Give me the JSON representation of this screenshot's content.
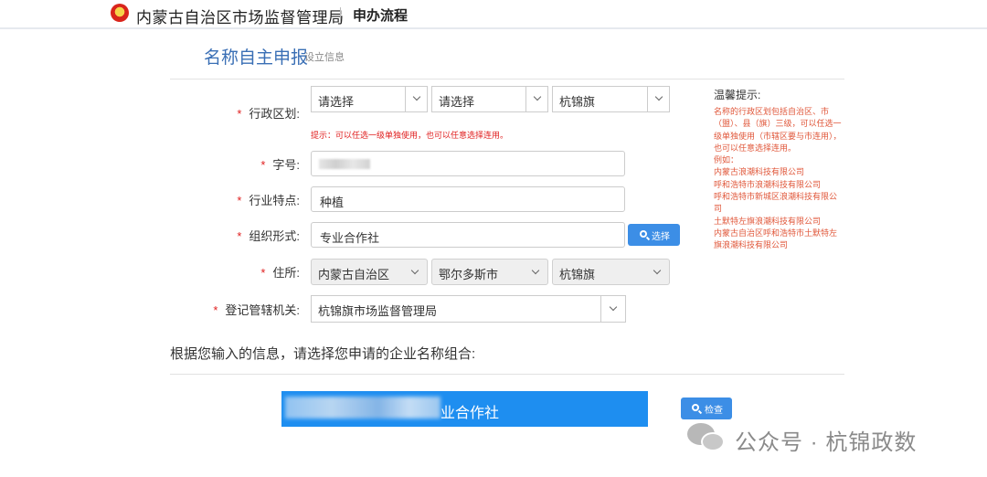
{
  "header": {
    "agency": "内蒙古自治区市场监督管理局",
    "flow_link": "申办流程"
  },
  "section": {
    "title": "名称自主申报",
    "subtitle": "设立信息"
  },
  "form": {
    "district": {
      "label": "行政区划:",
      "select1": "请选择",
      "select2": "请选择",
      "select3": "杭锦旗",
      "hint": "提示：可以任选一级单独使用，也可以任意选择连用。"
    },
    "zihao": {
      "label": "字号:"
    },
    "industry": {
      "label": "行业特点:",
      "value": "种植"
    },
    "org_form": {
      "label": "组织形式:",
      "value": "专业合作社",
      "button": "选择"
    },
    "address": {
      "label": "住所:",
      "select1": "内蒙古自治区",
      "select2": "鄂尔多斯市",
      "select3": "杭锦旗"
    },
    "authority": {
      "label": "登记管辖机关:",
      "value": "杭锦旗市场监督管理局"
    }
  },
  "tips": {
    "title": "温馨提示:",
    "lines": [
      "名称的行政区划包括自治区、市（盟）、县（旗）三级，可以任选一级单独使用（市辖区要与市连用），也可以任意选择连用。",
      "例如：",
      "内蒙古浪潮科技有限公司",
      "呼和浩特市浪潮科技有限公司",
      "呼和浩特市新城区浪潮科技有限公司",
      "土默特左旗浪潮科技有限公司",
      "内蒙古自治区呼和浩特市土默特左旗浪潮科技有限公司"
    ]
  },
  "combination": {
    "prompt": "根据您输入的信息，请选择您申请的企业名称组合:",
    "name_visible_tail": "业合作社",
    "check_button": "检查"
  },
  "watermark": {
    "text": "公众号 · 杭锦政数"
  },
  "colors": {
    "accent": "#3c8ee6",
    "required": "#e02020",
    "tips": "#e0573a",
    "title": "#3a6fb5"
  }
}
